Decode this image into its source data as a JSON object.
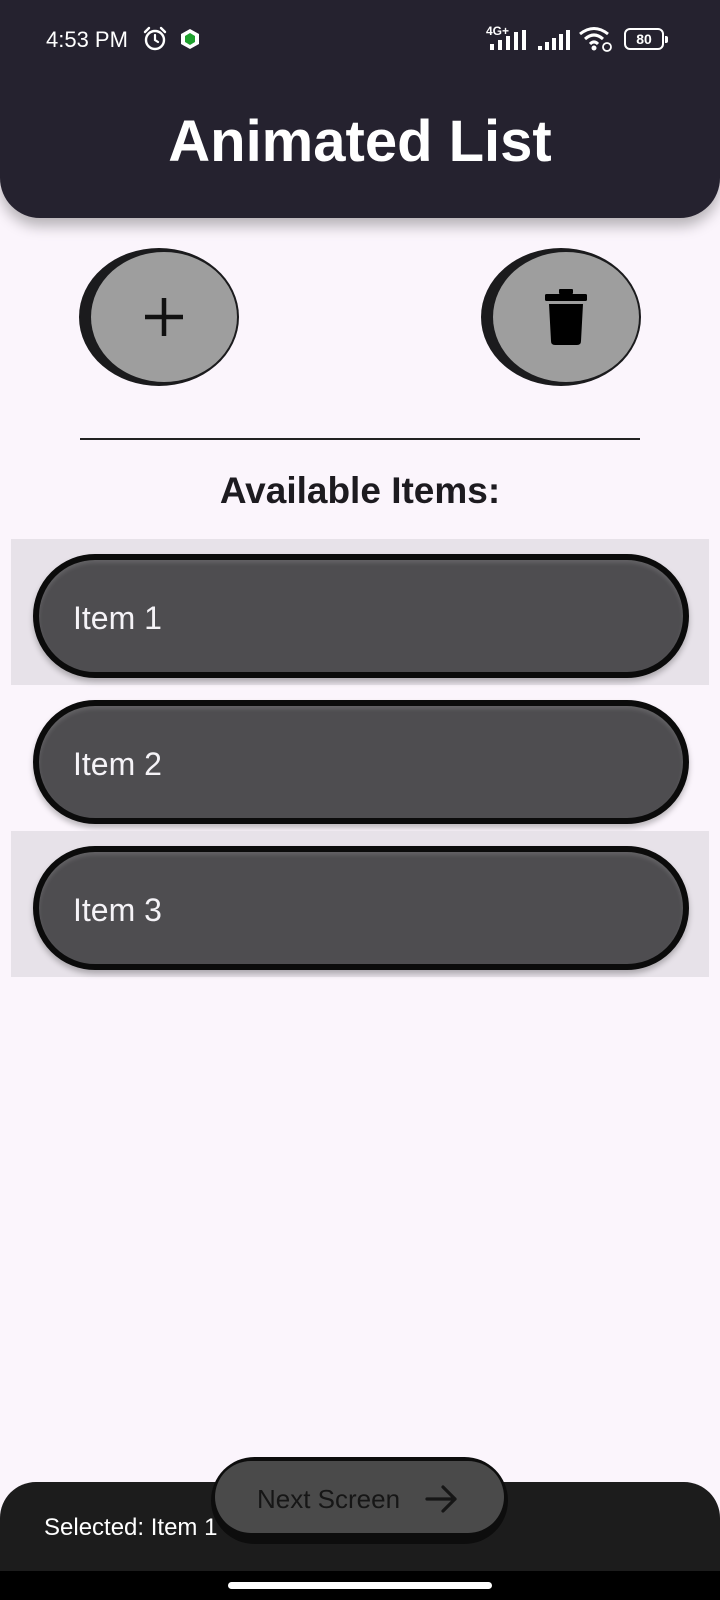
{
  "status_bar": {
    "time": "4:53 PM",
    "network": "4G+",
    "battery": "80",
    "icons": [
      "alarm-icon",
      "shield-icon",
      "signal-icon",
      "signal-icon",
      "wifi-icon",
      "battery-icon"
    ]
  },
  "header": {
    "title": "Animated List"
  },
  "actions": {
    "add_icon": "plus-icon",
    "delete_icon": "trash-icon"
  },
  "section": {
    "title": "Available Items:"
  },
  "items": [
    {
      "label": "Item 1"
    },
    {
      "label": "Item 2"
    },
    {
      "label": "Item 3"
    }
  ],
  "footer": {
    "selected_text": "Selected: Item 1",
    "next_button_label": "Next Screen",
    "next_icon": "arrow-right-icon"
  }
}
